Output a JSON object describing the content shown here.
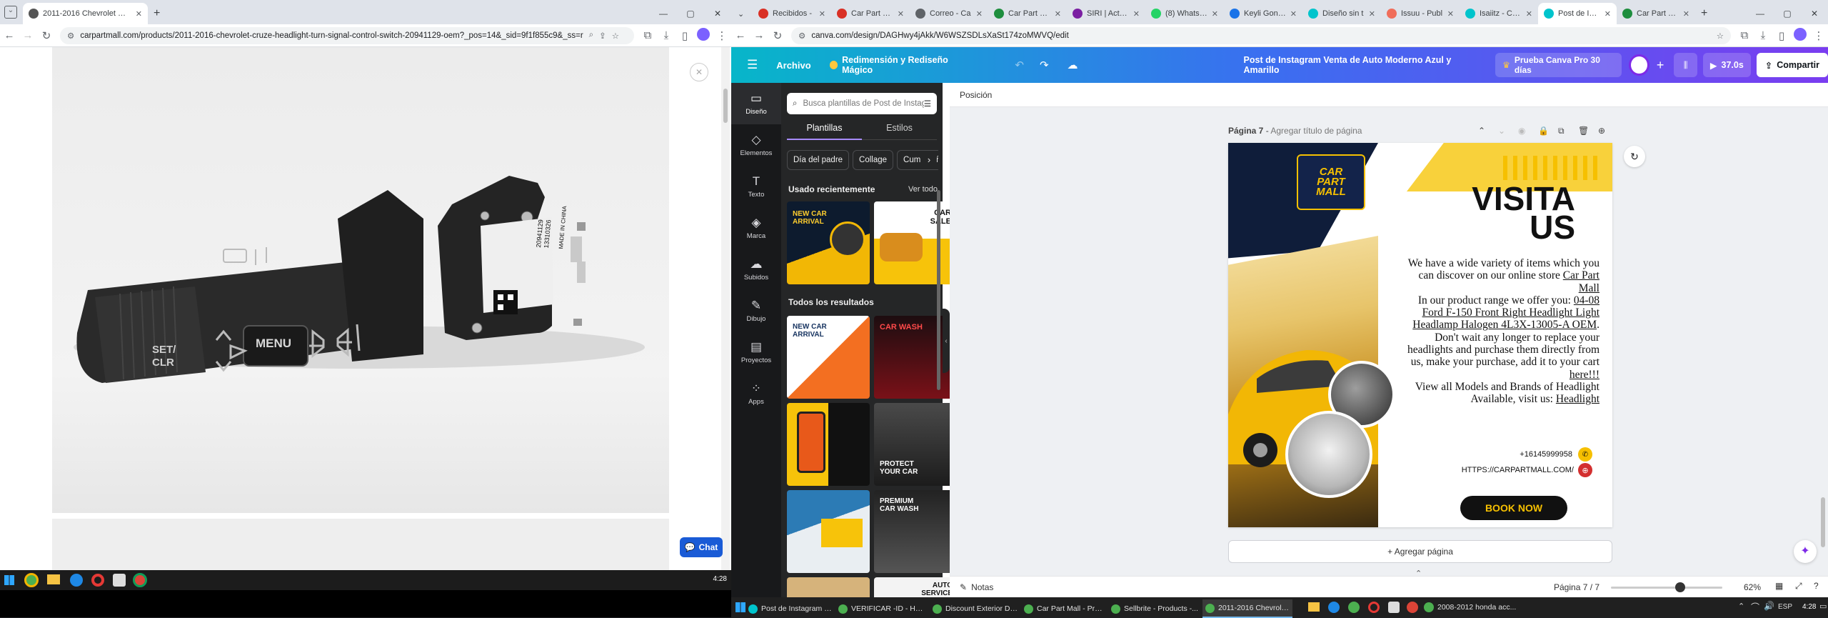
{
  "left_browser": {
    "tab": {
      "title": "2011-2016 Chevrolet Cruze He...",
      "close": "✕"
    },
    "new_tab": "+",
    "window_controls": [
      "—",
      "▢",
      "✕"
    ],
    "url": "carpartmall.com/products/2011-2016-chevrolet-cruze-headlight-turn-signal-control-switch-20941129-oem?_pos=14&_sid=9f1f855c9&_ss=r",
    "product_image_text": {
      "menu": "MENU",
      "set_clr": "SET/\nCLR",
      "label_code": "20941129\n13310326",
      "label_sub": "MADE IN CHINA"
    },
    "chat_button": "Chat",
    "close_viewer": "✕"
  },
  "right_browser": {
    "tabs": [
      {
        "title": "Recibidos -",
        "color": "#d93025"
      },
      {
        "title": "Car Part Ma",
        "color": "#d93025"
      },
      {
        "title": "Correo - Ca",
        "color": "#5f6368"
      },
      {
        "title": "Car Part Ma",
        "color": "#1e8e3e"
      },
      {
        "title": "SIRI | Activo",
        "color": "#7b1fa2"
      },
      {
        "title": "(8) WhatsAp",
        "color": "#25d366"
      },
      {
        "title": "Keyli Gonzá",
        "color": "#1a73e8"
      },
      {
        "title": "Diseño sin t",
        "color": "#00c4cc"
      },
      {
        "title": "Issuu - Publ",
        "color": "#f06d5a"
      },
      {
        "title": "Isaiitz - Canv",
        "color": "#00c4cc"
      },
      {
        "title": "Post de Insta",
        "color": "#00c4cc"
      },
      {
        "title": "Car Part Ma",
        "color": "#1e8e3e"
      }
    ],
    "url": "canva.com/design/DAGHwy4jAkk/W6WSZSDLsXaSt174zoMWVQ/edit"
  },
  "canva": {
    "toolbar": {
      "menu_icon": "☰",
      "archivo": "Archivo",
      "magic": "Redimensión y Rediseño Mágico",
      "title": "Post de Instagram Venta de Auto Moderno Azul y Amarillo",
      "trial": "Prueba Canva Pro 30 días",
      "plus": "+",
      "timer": "37.0s",
      "share": "Compartir"
    },
    "rail": [
      {
        "label": "Diseño",
        "icon": "▭"
      },
      {
        "label": "Elementos",
        "icon": "◇"
      },
      {
        "label": "Texto",
        "icon": "T"
      },
      {
        "label": "Marca",
        "icon": "◈"
      },
      {
        "label": "Subidos",
        "icon": "☁"
      },
      {
        "label": "Dibujo",
        "icon": "✎"
      },
      {
        "label": "Proyectos",
        "icon": "▤"
      },
      {
        "label": "Apps",
        "icon": "⁘"
      }
    ],
    "panel": {
      "search_placeholder": "Busca plantillas de Post de Instagram",
      "tab_plantillas": "Plantillas",
      "tab_estilos": "Estilos",
      "chips": [
        "Día del padre",
        "Collage",
        "Cumpleaños"
      ],
      "recent_heading": "Usado recientemente",
      "see_all": "Ver todo",
      "all_results": "Todos los resultados",
      "thumbs": [
        "NEW CAR ARRIVAL",
        "CAR SALE",
        "NEW CAR ARRIVAL",
        "CAR WASH",
        "",
        "PROTECT YOUR CAR",
        "",
        "PREMIUM CAR WASH",
        "",
        "AUTO SERVICE"
      ]
    },
    "position_label": "Posición",
    "page_header": {
      "page": "Página 7",
      "title_placeholder": "Agregar título de página"
    },
    "design": {
      "logo": "CAR\nPART\nMALL",
      "headline": "VISITA\nUS",
      "intro": "We have a wide variety of items which you can discover on our online store",
      "store_link": "Car Part Mall",
      "range": "In our product range we offer you:",
      "product_link": "04-08 Ford F-150 Front Right Headlight Light Headlamp Halogen 4L3X-13005-A OEM",
      "cta_text": ". Don't wait any longer to replace your headlights and purchase them directly from us, make your purchase, add it to your cart",
      "here_link": "here!!!",
      "models": "View all Models and Brands of Headlight Available, visit us:",
      "headlight_link": "Headlight",
      "phone": "+16145999958",
      "website": "HTTPS://CARPARTMALL.COM/",
      "book": "BOOK NOW"
    },
    "add_page": "+ Agregar página",
    "footer": {
      "notes": "Notas",
      "page_count": "Página 7 / 7",
      "zoom": "62%",
      "zoom_level": 0.62
    }
  },
  "taskbars": {
    "left_clock": "4:28",
    "right_items": [
      "Post de Instagram Ve...",
      "VERIFICAR -ID - Hoja...",
      "Discount Exterior Do...",
      "Car Part Mall - Produ...",
      "Sellbrite - Products -...",
      "2011-2016 Chevrolet ...",
      "2008-2012 honda acc..."
    ],
    "lang": "ESP",
    "right_clock": "4:28"
  },
  "colors": {
    "canva_dark": "#18191b",
    "accent_yellow": "#f6c000",
    "brand_purple": "#7d2ae8",
    "navy": "#0f1d3a"
  }
}
